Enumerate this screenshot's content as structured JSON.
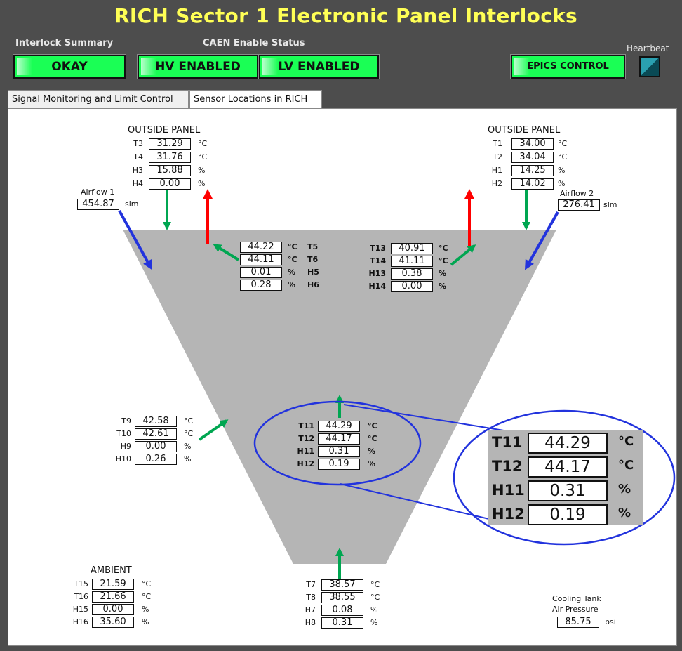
{
  "title": "RICH Sector 1 Electronic Panel Interlocks",
  "header": {
    "interlock_summary_label": "Interlock Summary",
    "caen_label": "CAEN Enable Status",
    "heartbeat_label": "Heartbeat",
    "okay": "OKAY",
    "hv": "HV ENABLED",
    "lv": "LV ENABLED",
    "epics": "EPICS CONTROL"
  },
  "tabs": [
    {
      "label": "Signal Monitoring and Limit Control",
      "active": false
    },
    {
      "label": "Sensor Locations in RICH",
      "active": true
    }
  ],
  "colors": {
    "status_green": "#1aff55",
    "title_yellow": "#ffff55",
    "arrow_green": "#00a651",
    "arrow_red": "#ff0000",
    "arrow_blue": "#2233dd",
    "cone_gray": "#b5b5b5"
  },
  "outside_left": {
    "header": "OUTSIDE PANEL",
    "rows": [
      {
        "label": "T3",
        "value": "31.29",
        "unit": "°C"
      },
      {
        "label": "T4",
        "value": "31.76",
        "unit": "°C"
      },
      {
        "label": "H3",
        "value": "15.88",
        "unit": "%"
      },
      {
        "label": "H4",
        "value": "0.00",
        "unit": "%"
      }
    ]
  },
  "outside_right": {
    "header": "OUTSIDE PANEL",
    "rows": [
      {
        "label": "T1",
        "value": "34.00",
        "unit": "°C"
      },
      {
        "label": "T2",
        "value": "34.04",
        "unit": "°C"
      },
      {
        "label": "H1",
        "value": "14.25",
        "unit": "%"
      },
      {
        "label": "H2",
        "value": "14.02",
        "unit": "%"
      }
    ]
  },
  "airflow1": {
    "label": "Airflow 1",
    "value": "454.87",
    "unit": "slm"
  },
  "airflow2": {
    "label": "Airflow 2",
    "value": "276.41",
    "unit": "slm"
  },
  "upper_left": [
    {
      "label": "T5",
      "value": "44.22",
      "unit": "°C"
    },
    {
      "label": "T6",
      "value": "44.11",
      "unit": "°C"
    },
    {
      "label": "H5",
      "value": "0.01",
      "unit": "%"
    },
    {
      "label": "H6",
      "value": "0.28",
      "unit": "%"
    }
  ],
  "upper_right": [
    {
      "label": "T13",
      "value": "40.91",
      "unit": "°C"
    },
    {
      "label": "T14",
      "value": "41.11",
      "unit": "°C"
    },
    {
      "label": "H13",
      "value": "0.38",
      "unit": "%"
    },
    {
      "label": "H14",
      "value": "0.00",
      "unit": "%"
    }
  ],
  "side": [
    {
      "label": "T9",
      "value": "42.58",
      "unit": "°C"
    },
    {
      "label": "T10",
      "value": "42.61",
      "unit": "°C"
    },
    {
      "label": "H9",
      "value": "0.00",
      "unit": "%"
    },
    {
      "label": "H10",
      "value": "0.26",
      "unit": "%"
    }
  ],
  "center": [
    {
      "label": "T11",
      "value": "44.29",
      "unit": "°C"
    },
    {
      "label": "T12",
      "value": "44.17",
      "unit": "°C"
    },
    {
      "label": "H11",
      "value": "0.31",
      "unit": "%"
    },
    {
      "label": "H12",
      "value": "0.19",
      "unit": "%"
    }
  ],
  "bottom": [
    {
      "label": "T7",
      "value": "38.57",
      "unit": "°C"
    },
    {
      "label": "T8",
      "value": "38.55",
      "unit": "°C"
    },
    {
      "label": "H7",
      "value": "0.08",
      "unit": "%"
    },
    {
      "label": "H8",
      "value": "0.31",
      "unit": "%"
    }
  ],
  "ambient": {
    "header": "AMBIENT",
    "rows": [
      {
        "label": "T15",
        "value": "21.59",
        "unit": "°C"
      },
      {
        "label": "T16",
        "value": "21.66",
        "unit": "°C"
      },
      {
        "label": "H15",
        "value": "0.00",
        "unit": "%"
      },
      {
        "label": "H16",
        "value": "35.60",
        "unit": "%"
      }
    ]
  },
  "cooling": {
    "line1": "Cooling Tank",
    "line2": "Air Pressure",
    "value": "85.75",
    "unit": "psi"
  }
}
